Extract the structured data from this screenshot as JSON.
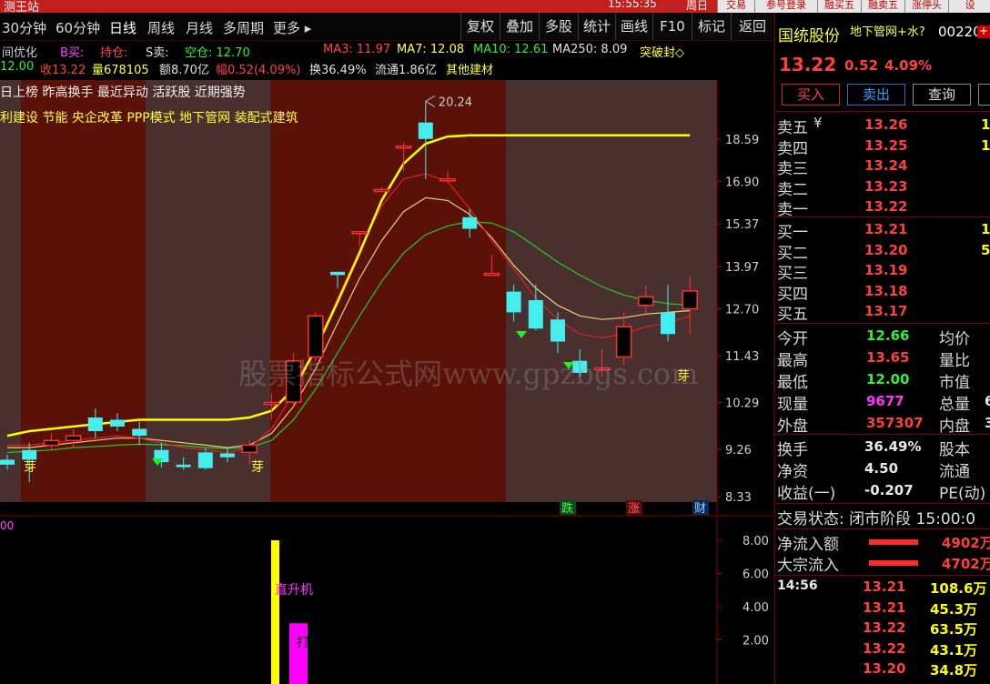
{
  "titlebar": {
    "title": "测王站",
    "clock": "15:55:35",
    "weekday": "周日",
    "buttons": [
      "交易",
      "参号登录",
      "融买五",
      "融卖五",
      "涨停头",
      "设"
    ]
  },
  "menu": {
    "periods": [
      "30分钟",
      "60分钟",
      "日线",
      "周线",
      "月线",
      "多周期",
      "更多 ▸"
    ],
    "active": "日线",
    "tools": [
      "复权",
      "叠加",
      "多股",
      "统计",
      "画线",
      "F10",
      "标记",
      "返回"
    ]
  },
  "indicator_row": {
    "name": "间优化",
    "b_label": "B买:",
    "hold_label": "持仓:",
    "s_label": "S卖:",
    "empty_label": "空仓: 12.70",
    "ma3": "MA3: 11.97",
    "ma7": "MA7: 12.08",
    "ma10": "MA10: 12.61",
    "ma250": "MA250: 8.09",
    "breakout": "突破封◇"
  },
  "stat_row": {
    "open": "12.00",
    "close": "收13.22",
    "volume": "量678105",
    "amount": "额8.70亿",
    "change": "幅0.52(4.09%)",
    "turnover": "换36.49%",
    "float": "流通1.86亿",
    "sector": "其他建材"
  },
  "tags": {
    "line1": "日上榜  昨高换手  最近异动  活跃股  近期强势",
    "line2": "利建设  节能  央企改革  PPP模式  地下管网  装配式建筑"
  },
  "watermark": "股票指标公式网www.gpzbgs.com",
  "chart_data": {
    "type": "candlestick",
    "price_axis": [
      "18.59",
      "16.90",
      "15.37",
      "13.97",
      "12.70",
      "11.43",
      "10.29",
      "9.26",
      "8.33"
    ],
    "max_label": "20.24",
    "candles": [
      {
        "o": 9.05,
        "c": 8.95,
        "h": 9.15,
        "l": 8.85
      },
      {
        "o": 9.25,
        "c": 9.05,
        "h": 9.4,
        "l": 8.6
      },
      {
        "o": 9.35,
        "c": 9.45,
        "h": 9.6,
        "l": 9.25
      },
      {
        "o": 9.45,
        "c": 9.55,
        "h": 9.7,
        "l": 9.3
      },
      {
        "o": 9.95,
        "c": 9.65,
        "h": 10.15,
        "l": 9.5
      },
      {
        "o": 9.9,
        "c": 9.75,
        "h": 10.05,
        "l": 9.65
      },
      {
        "o": 9.7,
        "c": 9.55,
        "h": 9.85,
        "l": 9.35
      },
      {
        "o": 9.25,
        "c": 9.0,
        "h": 9.4,
        "l": 8.9
      },
      {
        "o": 8.95,
        "c": 8.9,
        "h": 9.1,
        "l": 8.85
      },
      {
        "o": 9.2,
        "c": 8.88,
        "h": 9.3,
        "l": 8.85
      },
      {
        "o": 9.18,
        "c": 9.1,
        "h": 9.3,
        "l": 9.0
      },
      {
        "o": 9.2,
        "c": 9.35,
        "h": 9.45,
        "l": 8.95
      },
      {
        "o": 10.29,
        "c": 10.29,
        "h": 10.5,
        "l": 9.9
      },
      {
        "o": 10.3,
        "c": 11.3,
        "h": 11.5,
        "l": 10.2
      },
      {
        "o": 11.4,
        "c": 12.5,
        "h": 12.6,
        "l": 11.3
      },
      {
        "o": 13.8,
        "c": 13.7,
        "h": 13.8,
        "l": 13.3
      },
      {
        "o": 15.1,
        "c": 15.1,
        "h": 15.1,
        "l": 14.6
      },
      {
        "o": 16.6,
        "c": 16.6,
        "h": 16.7,
        "l": 16.5
      },
      {
        "o": 18.3,
        "c": 18.3,
        "h": 18.45,
        "l": 17.3
      },
      {
        "o": 19.3,
        "c": 18.6,
        "h": 20.24,
        "l": 17.0
      },
      {
        "o": 17.0,
        "c": 17.0,
        "h": 17.3,
        "l": 16.85
      },
      {
        "o": 15.6,
        "c": 15.2,
        "h": 15.9,
        "l": 14.9
      },
      {
        "o": 13.75,
        "c": 13.75,
        "h": 14.35,
        "l": 13.75
      },
      {
        "o": 13.2,
        "c": 12.6,
        "h": 13.4,
        "l": 12.35
      },
      {
        "o": 12.95,
        "c": 12.15,
        "h": 13.4,
        "l": 12.1
      },
      {
        "o": 12.4,
        "c": 11.8,
        "h": 12.6,
        "l": 11.5
      },
      {
        "o": 11.3,
        "c": 11.0,
        "h": 11.6,
        "l": 10.9
      },
      {
        "o": 11.1,
        "c": 11.12,
        "h": 11.6,
        "l": 10.9
      },
      {
        "o": 11.4,
        "c": 12.2,
        "h": 12.6,
        "l": 11.2
      },
      {
        "o": 12.8,
        "c": 13.05,
        "h": 13.4,
        "l": 12.55
      },
      {
        "o": 12.6,
        "c": 12.0,
        "h": 13.4,
        "l": 11.8
      },
      {
        "o": 12.7,
        "c": 13.22,
        "h": 13.65,
        "l": 12.0
      }
    ],
    "ma_yellow": [
      9.55,
      9.65,
      9.7,
      9.75,
      9.8,
      9.85,
      9.9,
      9.9,
      9.9,
      9.9,
      9.9,
      9.95,
      10.1,
      10.6,
      11.6,
      12.9,
      14.4,
      16.2,
      17.6,
      18.4,
      18.7,
      18.75,
      18.75,
      18.75,
      18.75,
      18.75,
      18.75,
      18.75,
      18.75,
      18.75,
      18.75,
      18.75
    ],
    "ma_red": [
      9.35,
      9.35,
      9.4,
      9.45,
      9.5,
      9.55,
      9.5,
      9.4,
      9.3,
      9.25,
      9.2,
      9.3,
      9.7,
      10.5,
      11.6,
      13.0,
      14.5,
      16.0,
      17.0,
      17.2,
      16.9,
      15.9,
      14.8,
      13.9,
      13.0,
      12.4,
      12.0,
      11.9,
      12.0,
      12.2,
      12.3,
      12.5
    ],
    "ma_pale": [
      9.3,
      9.3,
      9.35,
      9.4,
      9.45,
      9.5,
      9.5,
      9.45,
      9.4,
      9.35,
      9.3,
      9.35,
      9.6,
      10.2,
      11.1,
      12.3,
      13.6,
      14.8,
      15.8,
      16.3,
      16.2,
      15.7,
      14.9,
      14.0,
      13.3,
      12.8,
      12.5,
      12.4,
      12.45,
      12.55,
      12.6,
      12.65
    ],
    "ma_green": [
      9.2,
      9.22,
      9.25,
      9.3,
      9.32,
      9.35,
      9.37,
      9.36,
      9.34,
      9.3,
      9.28,
      9.3,
      9.45,
      9.9,
      10.6,
      11.5,
      12.5,
      13.5,
      14.4,
      15.0,
      15.3,
      15.45,
      15.4,
      15.1,
      14.6,
      14.1,
      13.7,
      13.35,
      13.1,
      12.95,
      12.85,
      12.8
    ],
    "markers": [
      "芽",
      "芽",
      "芽"
    ],
    "event_badges": [
      "跌",
      "涨",
      "财"
    ],
    "sub_axis": [
      "8.00",
      "6.00",
      "4.00",
      "2.00"
    ],
    "sub_bars": [
      {
        "label": "直升机",
        "value": 8.0,
        "color": "#ffff00"
      },
      {
        "label": "打板",
        "value": 3.0,
        "color": "#ff00ff"
      }
    ],
    "sub_left_label": "00"
  },
  "right": {
    "stock_name": "国统股份",
    "tag": "地下管网+水?",
    "code": "00220",
    "price": "13.22",
    "change": "0.52",
    "pct": "4.09%",
    "buttons": [
      "买入",
      "卖出",
      "查询"
    ],
    "asks": [
      {
        "label": "卖五",
        "price": "13.26",
        "vol": "1"
      },
      {
        "label": "卖四",
        "price": "13.25",
        "vol": "1"
      },
      {
        "label": "卖三",
        "price": "13.24",
        "vol": ""
      },
      {
        "label": "卖二",
        "price": "13.23",
        "vol": ""
      },
      {
        "label": "卖一",
        "price": "13.22",
        "vol": ""
      }
    ],
    "bids": [
      {
        "label": "买一",
        "price": "13.21",
        "vol": "1"
      },
      {
        "label": "买二",
        "price": "13.20",
        "vol": "5"
      },
      {
        "label": "买三",
        "price": "13.19",
        "vol": ""
      },
      {
        "label": "买四",
        "price": "13.18",
        "vol": ""
      },
      {
        "label": "买五",
        "price": "13.17",
        "vol": ""
      }
    ],
    "stats": [
      {
        "l1": "今开",
        "v1": "12.66",
        "c1": "green",
        "l2": "均价"
      },
      {
        "l1": "最高",
        "v1": "13.65",
        "c1": "red",
        "l2": "量比"
      },
      {
        "l1": "最低",
        "v1": "12.00",
        "c1": "green",
        "l2": "市值"
      },
      {
        "l1": "现量",
        "v1": "9677",
        "c1": "mag",
        "l2": "总量",
        "v2": "6"
      },
      {
        "l1": "外盘",
        "v1": "357307",
        "c1": "red",
        "l2": "内盘",
        "v2": "3"
      }
    ],
    "stats2": [
      {
        "l1": "换手",
        "v1": "36.49%",
        "l2": "股本"
      },
      {
        "l1": "净资",
        "v1": "4.50",
        "l2": "流通"
      },
      {
        "l1": "收益(一)",
        "v1": "-0.207",
        "l2": "PE(动)"
      }
    ],
    "status": "交易状态: 闭市阶段 15:00:0",
    "flows": [
      {
        "label": "净流入额",
        "value": "4902万"
      },
      {
        "label": "大宗流入",
        "value": "4702万"
      }
    ],
    "ticks": [
      {
        "time": "14:56",
        "price": "13.21",
        "vol": "108.6万"
      },
      {
        "time": "",
        "price": "13.21",
        "vol": "45.3万"
      },
      {
        "time": "",
        "price": "13.22",
        "vol": "63.5万"
      },
      {
        "time": "",
        "price": "13.22",
        "vol": "43.1万"
      },
      {
        "time": "",
        "price": "13.20",
        "vol": "34.8万"
      }
    ]
  }
}
